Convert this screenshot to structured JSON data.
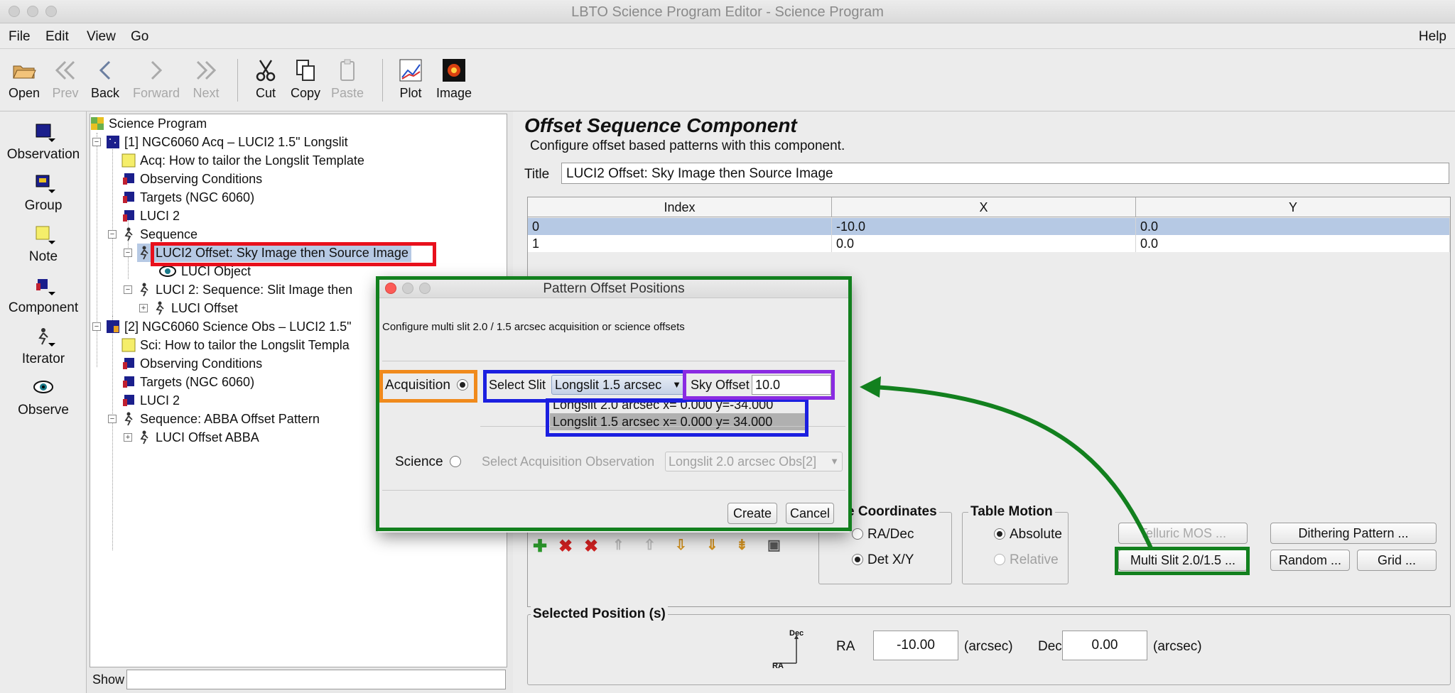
{
  "window": {
    "title": "LBTO Science Program Editor - Science Program"
  },
  "menu": {
    "file": "File",
    "edit": "Edit",
    "view": "View",
    "go": "Go",
    "help": "Help"
  },
  "toolbar": {
    "open": "Open",
    "prev": "Prev",
    "back": "Back",
    "forward": "Forward",
    "next": "Next",
    "cut": "Cut",
    "copy": "Copy",
    "paste": "Paste",
    "plot": "Plot",
    "image": "Image"
  },
  "palette": {
    "observation": "Observation",
    "group": "Group",
    "note": "Note",
    "component": "Component",
    "iterator": "Iterator",
    "observe": "Observe"
  },
  "tree": {
    "root": "Science Program",
    "n1": "[1] NGC6060 Acq – LUCI2  1.5\" Longslit",
    "n1_note": "Acq: How to tailor the Longslit Template",
    "n1_cond": "Observing Conditions",
    "n1_targets": "Targets (NGC 6060)",
    "n1_luci": "LUCI 2",
    "n1_seq": "Sequence",
    "n1_offset": "LUCI2 Offset: Sky Image then Source Image",
    "n1_object": "LUCI Object",
    "n1_seq2": "LUCI 2: Sequence: Slit Image then",
    "n1_offset2": "LUCI Offset",
    "n2": "[2] NGC6060 Science Obs – LUCI2  1.5\"",
    "n2_note": "Sci: How to tailor the Longslit Templa",
    "n2_cond": "Observing Conditions",
    "n2_targets": "Targets (NGC 6060)",
    "n2_luci": "LUCI 2",
    "n2_seq": "Sequence: ABBA Offset Pattern",
    "n2_offset": "LUCI Offset ABBA"
  },
  "show": {
    "label": "Show",
    "value": ""
  },
  "component": {
    "heading": "Offset Sequence Component",
    "subtitle": "Configure offset based patterns with this component.",
    "title_label": "Title",
    "title_value": "LUCI2 Offset: Sky Image then Source Image",
    "columns": [
      "Index",
      "X",
      "Y"
    ],
    "rows": [
      {
        "index": "0",
        "x": "-10.0",
        "y": "0.0"
      },
      {
        "index": "1",
        "x": "0.0",
        "y": "0.0"
      }
    ],
    "coords_title": "e Coordinates",
    "coords_radec": "RA/Dec",
    "coords_detxy": "Det X/Y",
    "motion_title": "Table Motion",
    "motion_absolute": "Absolute",
    "motion_relative": "Relative",
    "btn_telluric": "Telluric MOS ...",
    "btn_multislit": "Multi Slit 2.0/1.5 ...",
    "btn_dithering": "Dithering Pattern ...",
    "btn_random": "Random ...",
    "btn_grid": "Grid ...",
    "selected_title": "Selected Position (s)",
    "ra_label": "RA",
    "ra_value": "-10.00",
    "dec_label": "Dec",
    "dec_value": "0.00",
    "unit": "(arcsec)",
    "axis_dec": "Dec",
    "axis_ra": "RA"
  },
  "dialog": {
    "title": "Pattern Offset Positions",
    "description": "Configure multi slit 2.0 / 1.5 arcsec acquisition or science offsets",
    "acquisition": "Acquisition",
    "select_slit": "Select Slit",
    "slit_value": "Longslit 1.5 arcsec",
    "sky_offset_label": "Sky Offset",
    "sky_offset_value": "10.0",
    "options": [
      "Longslit 2.0 arcsec x= 0.000 y=-34.000",
      "Longslit 1.5 arcsec x= 0.000 y= 34.000"
    ],
    "science": "Science",
    "select_acq_obs": "Select Acquisition Observation",
    "acq_obs_value": "Longslit 2.0 arcsec Obs[2]",
    "create": "Create",
    "cancel": "Cancel"
  },
  "colors": {
    "highlight_red": "#e8101c",
    "highlight_orange": "#f08a1c",
    "highlight_blue": "#1b1fe0",
    "highlight_purple": "#8a2be2",
    "highlight_green": "#12801e",
    "selection": "#b6c9e4"
  }
}
